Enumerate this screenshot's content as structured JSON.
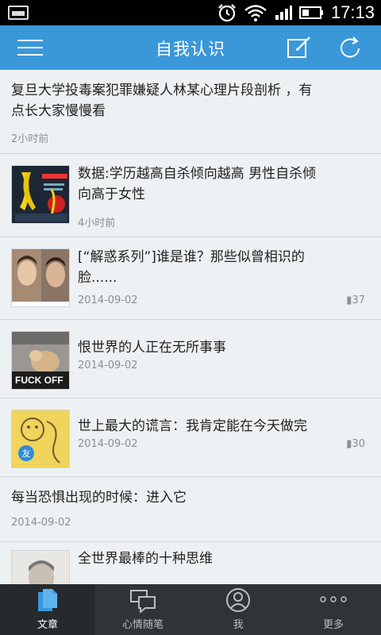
{
  "status_bar": {
    "time": "17:13",
    "icons": [
      "screenshot-icon",
      "alarm-icon",
      "wifi-icon",
      "signal-icon",
      "battery-icon"
    ]
  },
  "header": {
    "title": "自我认识",
    "icons": [
      "menu-icon",
      "edit-icon",
      "refresh-icon"
    ]
  },
  "articles": [
    {
      "title_lines": [
        "复旦大学投毒案犯罪嫌疑人林某心理片段剖析 ，有",
        "点长大家慢慢看"
      ],
      "time": "2小时前",
      "count": ""
    },
    {
      "title_lines": [
        "数据:学历越高自杀倾向越高 男性自杀倾",
        "向高于女性"
      ],
      "time": "4小时前",
      "count": ""
    },
    {
      "title_lines": [
        "[“解惑系列”]谁是谁？那些似曾相识的",
        "脸......"
      ],
      "time": "2014-09-02",
      "count": "37"
    },
    {
      "title_lines": [
        "恨世界的人正在无所事事"
      ],
      "time": "2014-09-02",
      "count": "",
      "thumb_text": "FUCK OFF"
    },
    {
      "title_lines": [
        "世上最大的谎言：我肯定能在今天做完"
      ],
      "time": "2014-09-02",
      "count": "30"
    },
    {
      "title_lines": [
        "每当恐惧出现的时候：进入它"
      ],
      "time": "2014-09-02",
      "count": ""
    },
    {
      "title_lines": [
        "全世界最棒的十种思维"
      ],
      "time": "",
      "count": ""
    }
  ],
  "bottom_tabs": [
    {
      "label": "文章",
      "icon": "document-icon",
      "active": true
    },
    {
      "label": "心情随笔",
      "icon": "chat-icon",
      "active": false
    },
    {
      "label": "我",
      "icon": "user-icon",
      "active": false
    },
    {
      "label": "更多",
      "icon": "more-icon",
      "active": false
    }
  ],
  "colors": {
    "header": "#3a98d9",
    "bottom_bar": "#2f3438",
    "active_tab_icon": "#3a98d9",
    "background": "#eef1f3"
  }
}
